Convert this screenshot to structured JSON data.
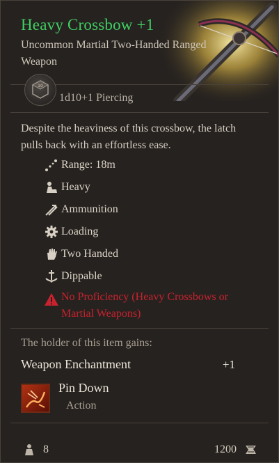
{
  "item": {
    "name": "Heavy Crossbow +1",
    "subtitle": "Uncommon Martial Two-Handed Ranged Weapon",
    "damage": "1d10+1 Piercing",
    "description": "Despite the heaviness of this crossbow, the latch pulls back with an effortless ease.",
    "name_color": "#3fcf63"
  },
  "properties": [
    {
      "label": "Range: 18m",
      "icon": "range-icon"
    },
    {
      "label": "Heavy",
      "icon": "heavy-icon"
    },
    {
      "label": "Ammunition",
      "icon": "ammunition-icon"
    },
    {
      "label": "Loading",
      "icon": "loading-gear-icon"
    },
    {
      "label": "Two Handed",
      "icon": "two-handed-icon"
    },
    {
      "label": "Dippable",
      "icon": "dippable-icon"
    }
  ],
  "warning": {
    "text": "No Proficiency (Heavy Crossbows or Martial Weapons)",
    "color": "#c8222f",
    "icon": "warning-icon"
  },
  "gains": {
    "heading": "The holder of this item gains:",
    "enchantment_label": "Weapon Enchantment",
    "enchantment_value": "+1"
  },
  "action": {
    "name": "Pin Down",
    "type": "Action",
    "icon": "pin-down-icon"
  },
  "footer": {
    "weight": "8",
    "price": "1200"
  }
}
